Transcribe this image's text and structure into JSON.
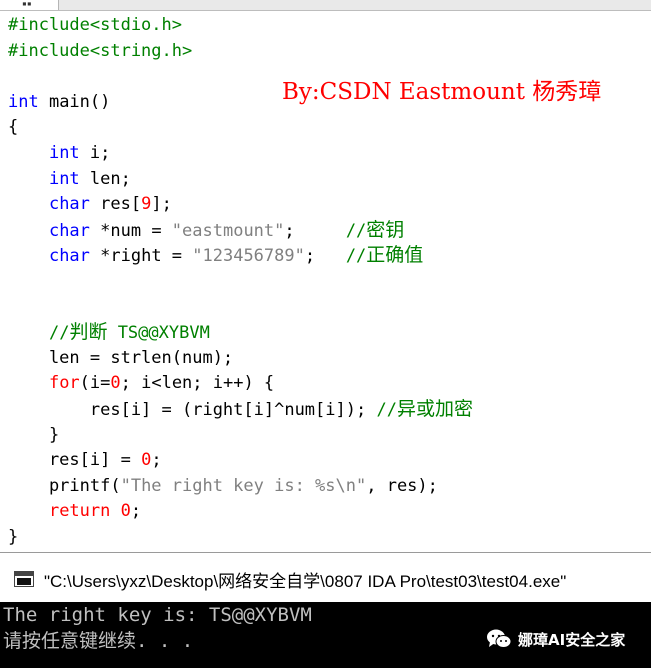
{
  "editor": {
    "lines": [
      {
        "parts": [
          {
            "t": "#include<stdio.h>",
            "c": "pp"
          }
        ]
      },
      {
        "parts": [
          {
            "t": "#include<string.h>",
            "c": "pp"
          }
        ]
      },
      {
        "parts": []
      },
      {
        "parts": [
          {
            "t": "int",
            "c": "kw"
          },
          {
            "t": " main()",
            "c": ""
          }
        ]
      },
      {
        "parts": [
          {
            "t": "{",
            "c": ""
          }
        ]
      },
      {
        "parts": [
          {
            "t": "    ",
            "c": ""
          },
          {
            "t": "int",
            "c": "kw"
          },
          {
            "t": " i;",
            "c": ""
          }
        ]
      },
      {
        "parts": [
          {
            "t": "    ",
            "c": ""
          },
          {
            "t": "int",
            "c": "kw"
          },
          {
            "t": " len;",
            "c": ""
          }
        ]
      },
      {
        "parts": [
          {
            "t": "    ",
            "c": ""
          },
          {
            "t": "char",
            "c": "kw"
          },
          {
            "t": " res[",
            "c": ""
          },
          {
            "t": "9",
            "c": "num"
          },
          {
            "t": "];",
            "c": ""
          }
        ]
      },
      {
        "parts": [
          {
            "t": "    ",
            "c": ""
          },
          {
            "t": "char",
            "c": "kw"
          },
          {
            "t": " *num = ",
            "c": ""
          },
          {
            "t": "\"eastmount\"",
            "c": "str"
          },
          {
            "t": ";     ",
            "c": ""
          },
          {
            "t": "//",
            "c": "cmt"
          },
          {
            "t": "密钥",
            "c": "cmtcn"
          }
        ]
      },
      {
        "parts": [
          {
            "t": "    ",
            "c": ""
          },
          {
            "t": "char",
            "c": "kw"
          },
          {
            "t": " *right = ",
            "c": ""
          },
          {
            "t": "\"123456789\"",
            "c": "str"
          },
          {
            "t": ";   ",
            "c": ""
          },
          {
            "t": "//",
            "c": "cmt"
          },
          {
            "t": "正确值",
            "c": "cmtcn"
          }
        ]
      },
      {
        "parts": []
      },
      {
        "parts": []
      },
      {
        "parts": [
          {
            "t": "    ",
            "c": ""
          },
          {
            "t": "//",
            "c": "cmt"
          },
          {
            "t": "判断",
            "c": "cmtcn"
          },
          {
            "t": " TS@@XYBVM",
            "c": "cmt"
          }
        ]
      },
      {
        "parts": [
          {
            "t": "    len = strlen(num);",
            "c": ""
          }
        ]
      },
      {
        "parts": [
          {
            "t": "    ",
            "c": ""
          },
          {
            "t": "for",
            "c": "ctrl"
          },
          {
            "t": "(i=",
            "c": ""
          },
          {
            "t": "0",
            "c": "num"
          },
          {
            "t": "; i<len; i++) {",
            "c": ""
          }
        ]
      },
      {
        "parts": [
          {
            "t": "        res[i] = (right[i]^num[i]); ",
            "c": ""
          },
          {
            "t": "//",
            "c": "cmt"
          },
          {
            "t": "异或加密",
            "c": "cmtcn"
          }
        ]
      },
      {
        "parts": [
          {
            "t": "    }",
            "c": ""
          }
        ]
      },
      {
        "parts": [
          {
            "t": "    res[i] = ",
            "c": ""
          },
          {
            "t": "0",
            "c": "num"
          },
          {
            "t": ";",
            "c": ""
          }
        ]
      },
      {
        "parts": [
          {
            "t": "    printf(",
            "c": ""
          },
          {
            "t": "\"The right key is: %s\\n\"",
            "c": "str"
          },
          {
            "t": ", res);",
            "c": ""
          }
        ]
      },
      {
        "parts": [
          {
            "t": "    ",
            "c": ""
          },
          {
            "t": "return",
            "c": "ctrl"
          },
          {
            "t": " ",
            "c": ""
          },
          {
            "t": "0",
            "c": "num"
          },
          {
            "t": ";",
            "c": ""
          }
        ]
      },
      {
        "parts": [
          {
            "t": "}",
            "c": ""
          }
        ]
      }
    ]
  },
  "author_label": "By:CSDN Eastmount 杨秀璋",
  "console": {
    "title": "\"C:\\Users\\yxz\\Desktop\\网络安全自学\\0807 IDA Pro\\test03\\test04.exe\"",
    "output_line1": "The right key is: TS@@XYBVM",
    "output_line2": "请按任意键继续. . ."
  },
  "watermark": {
    "text": "娜璋AI安全之家",
    "icon": "wechat-icon"
  },
  "tab": {
    "icon": "tab-dots"
  }
}
